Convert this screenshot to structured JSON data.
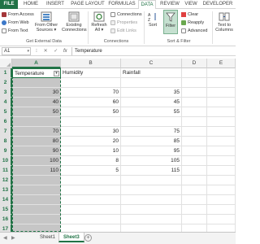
{
  "ribbon_tabs": [
    "FILE",
    "HOME",
    "INSERT",
    "PAGE LAYOUT",
    "FORMULAS",
    "DATA",
    "REVIEW",
    "VIEW",
    "DEVELOPER"
  ],
  "active_tab": "DATA",
  "get_external_data": {
    "from_access": "From Access",
    "from_web": "From Web",
    "from_text": "From Text",
    "from_other_line1": "From Other",
    "from_other_line2": "Sources",
    "existing_line1": "Existing",
    "existing_line2": "Connections",
    "group_label": "Get External Data"
  },
  "connections": {
    "refresh_line1": "Refresh",
    "refresh_line2": "All",
    "connections_label": "Connections",
    "properties_label": "Properties",
    "edit_links_label": "Edit Links",
    "group_label": "Connections"
  },
  "sort_filter": {
    "sort_label": "Sort",
    "filter_label": "Filter",
    "clear_label": "Clear",
    "reapply_label": "Reapply",
    "advanced_label": "Advanced",
    "group_label": "Sort & Filter"
  },
  "text_to_columns": {
    "line1": "Text to",
    "line2": "Columns"
  },
  "formula_bar": {
    "name_box": "A1",
    "fx": "fx",
    "content": "Temperature"
  },
  "columns": [
    "A",
    "B",
    "C",
    "D",
    "E"
  ],
  "rows": [
    "1",
    "2",
    "3",
    "4",
    "5",
    "6",
    "7",
    "8",
    "9",
    "10",
    "11",
    "12",
    "13",
    "14",
    "15",
    "16",
    "17"
  ],
  "cells": {
    "A1": "Temperature",
    "B1": "Humidity",
    "C1": "Rainfall",
    "A3": "30",
    "B3": "70",
    "C3": "35",
    "A4": "40",
    "B4": "60",
    "C4": "45",
    "A5": "50",
    "B5": "50",
    "C5": "55",
    "A7": "70",
    "B7": "30",
    "C7": "75",
    "A8": "80",
    "B8": "20",
    "C8": "85",
    "A9": "90",
    "B9": "10",
    "C9": "95",
    "A10": "100",
    "B10": "8",
    "C10": "105",
    "A11": "110",
    "B11": "5",
    "C11": "115"
  },
  "sheets": [
    "Sheet1",
    "Sheet3"
  ],
  "active_sheet": "Sheet3",
  "colors": {
    "accent": "#217346",
    "selection": "#c6c6c6"
  }
}
